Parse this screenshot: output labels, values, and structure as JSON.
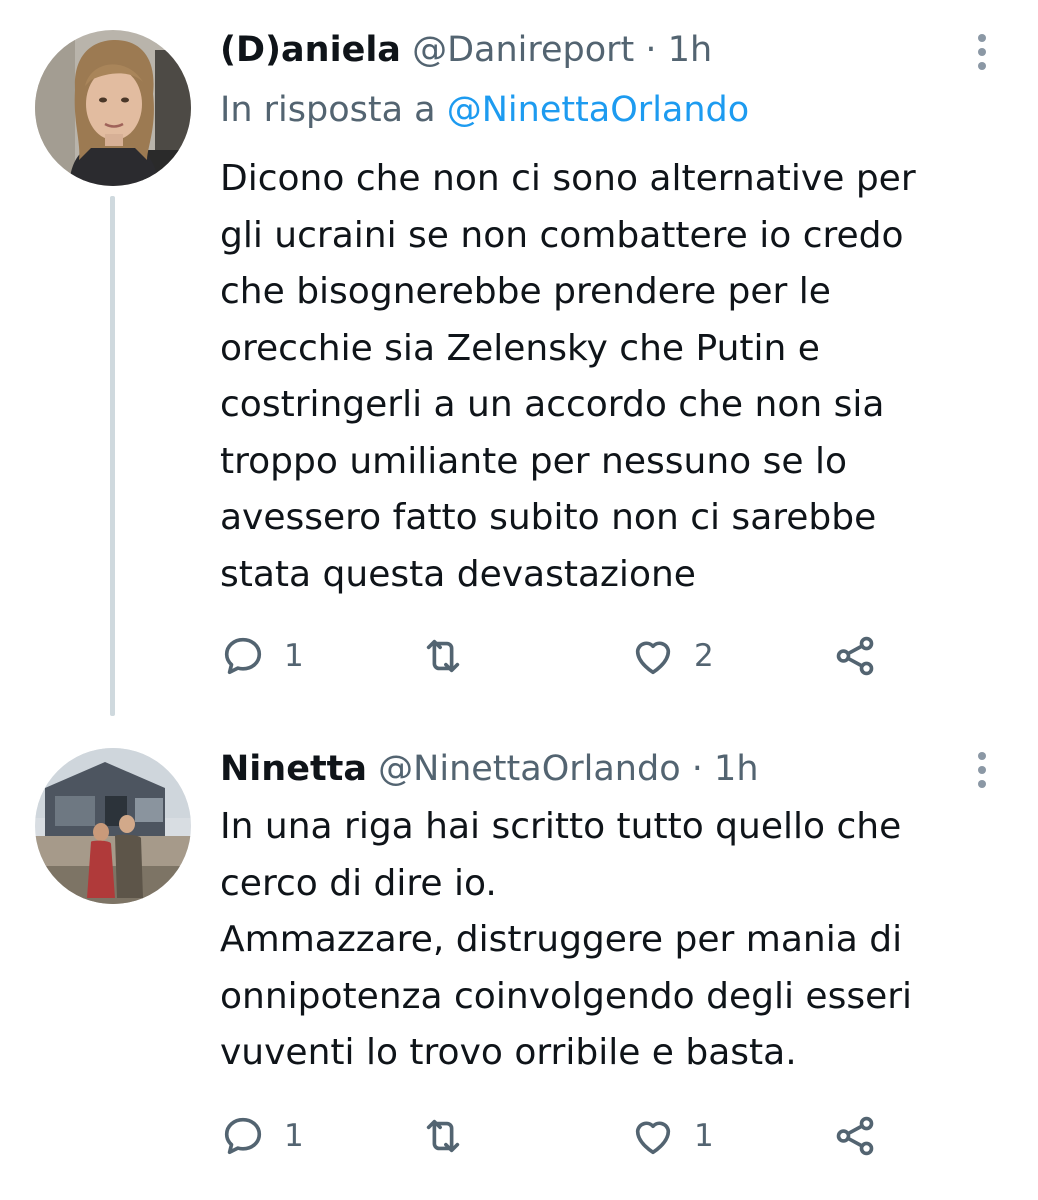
{
  "tweets": [
    {
      "display_name": "(D)aniela",
      "handle": "@Danireport",
      "separator": "·",
      "time": "1h",
      "reply_prefix": "In risposta a",
      "reply_handle": "@NinettaOrlando",
      "body_lines": [
        "Dicono che non ci sono alternative per",
        "gli ucraini se non combattere io credo",
        "che bisognerebbe prendere per le",
        "orecchie sia Zelensky che Putin e",
        "costringerli a un accordo che non sia",
        "troppo umiliante per nessuno se lo",
        "avessero fatto subito non ci sarebbe",
        "stata questa devastazione"
      ],
      "reply_count": "1",
      "like_count": "2"
    },
    {
      "display_name": "Ninetta",
      "handle": "@NinettaOrlando",
      "separator": "·",
      "time": "1h",
      "body_lines": [
        "In una riga hai scritto tutto quello che",
        "cerco di dire io.",
        "Ammazzare, distruggere per mania di",
        "onnipotenza coinvolgendo degli esseri",
        "vuventi lo trovo orribile e basta."
      ],
      "reply_count": "1",
      "like_count": "1"
    }
  ],
  "icons": {
    "reply": "speech-bubble-icon",
    "retweet": "retweet-arrows-icon",
    "like": "heart-outline-icon",
    "share": "share-nodes-icon",
    "more": "vertical-ellipsis-icon"
  },
  "colors": {
    "text": "#0f1419",
    "secondary": "#536471",
    "link": "#1d9bf0",
    "thread_line": "#cfd9de"
  }
}
